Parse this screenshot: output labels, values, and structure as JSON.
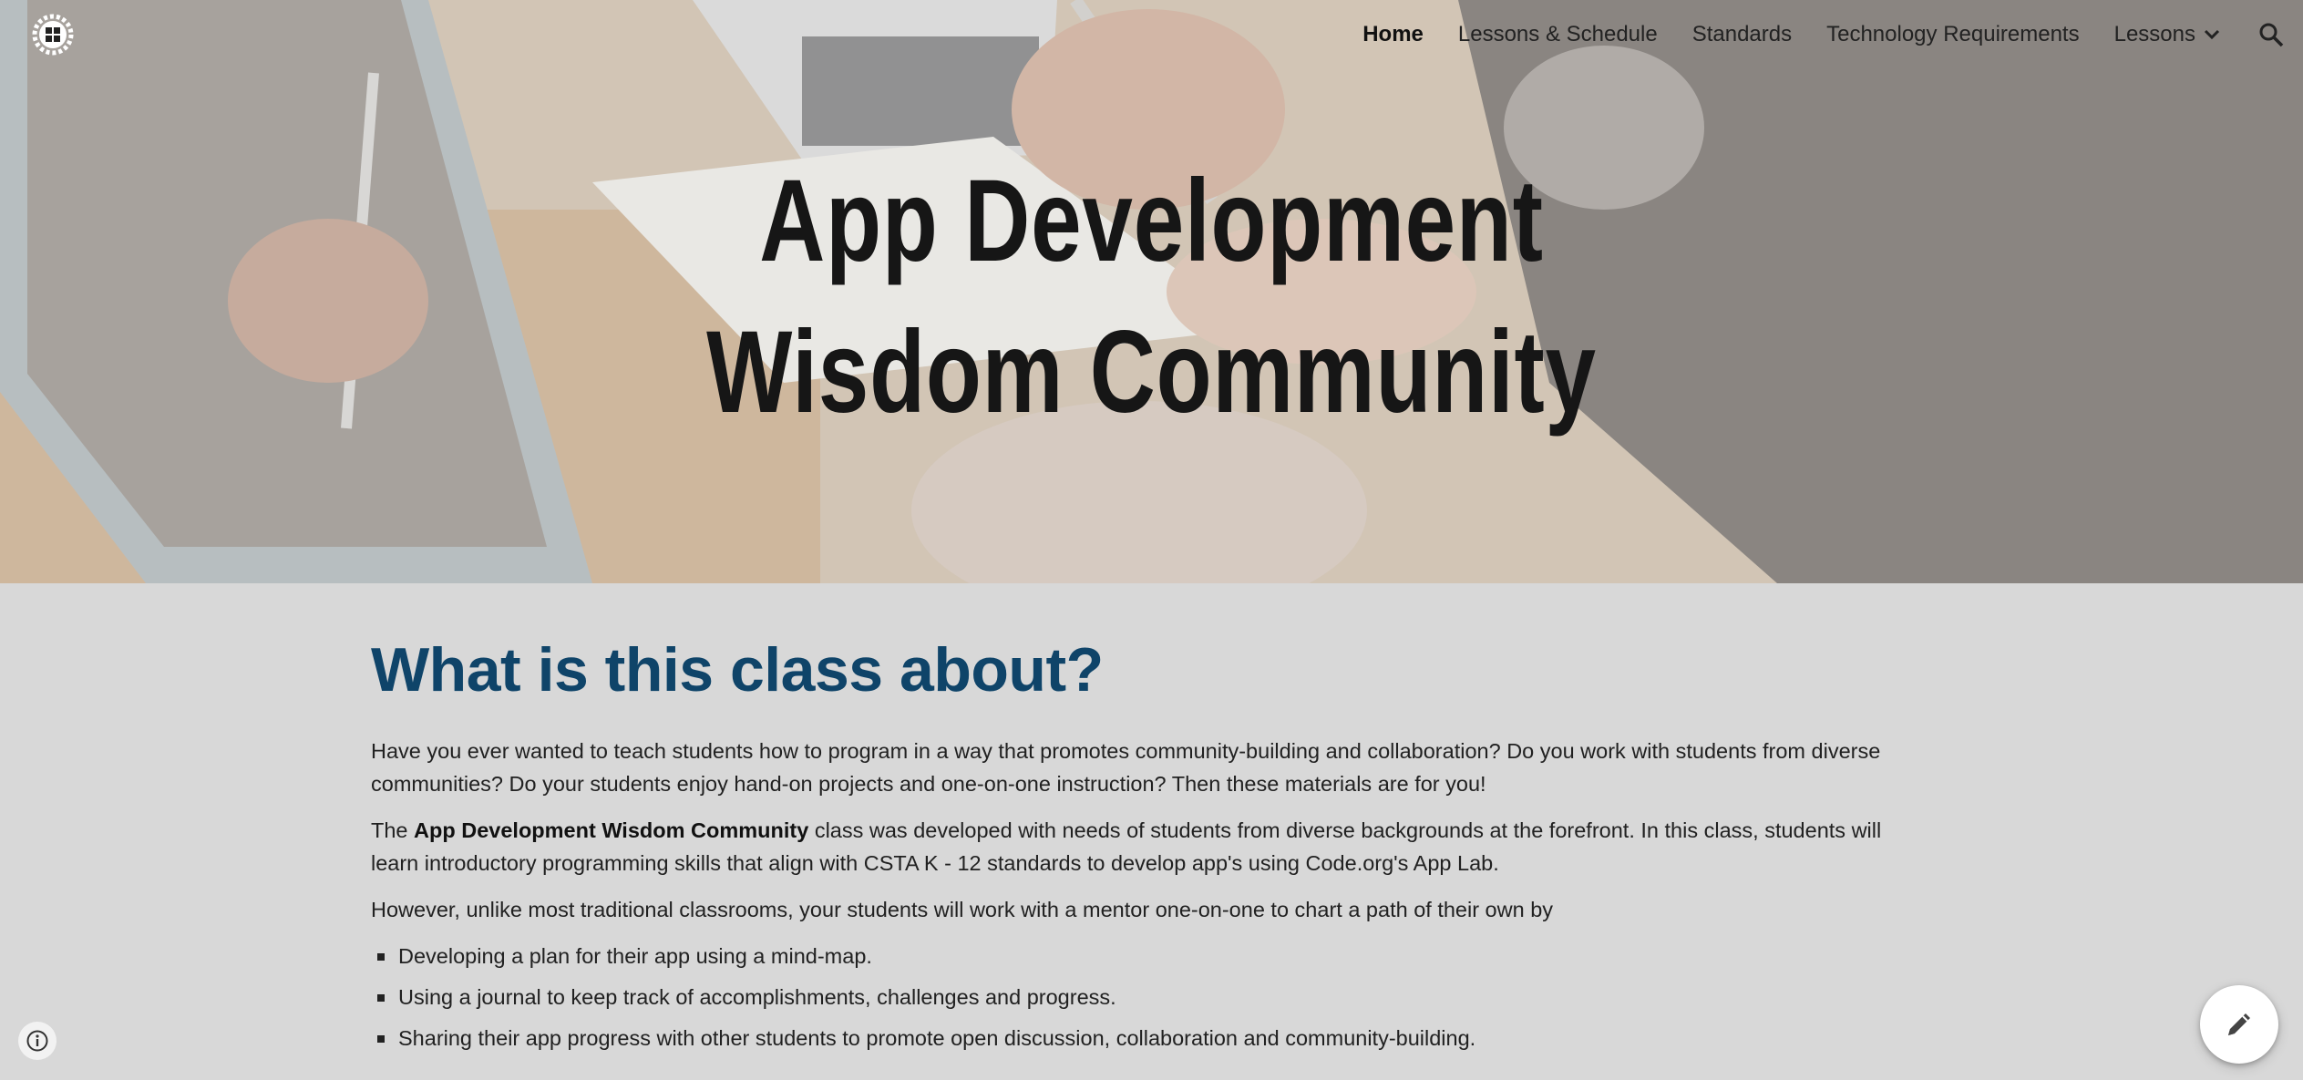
{
  "header": {
    "logo_icon": "site-logo-icon",
    "nav": [
      {
        "label": "Home",
        "active": true
      },
      {
        "label": "Lessons & Schedule",
        "active": false
      },
      {
        "label": "Standards",
        "active": false
      },
      {
        "label": "Technology Requirements",
        "active": false
      }
    ],
    "dropdown": {
      "label": "Lessons",
      "icon": "chevron-down-icon"
    },
    "search_icon": "search-icon"
  },
  "hero": {
    "title_line1": "App Development",
    "title_line2": "Wisdom Community"
  },
  "main": {
    "heading": "What is this class about?",
    "para1": "Have you ever wanted to teach students how to program in a way that promotes community-building and collaboration? Do you work with students from diverse communities? Do your students enjoy hand-on projects and one-on-one instruction? Then these materials are for you!",
    "para2_prefix": "The ",
    "para2_bold": "App Development Wisdom Community",
    "para2_suffix": " class was developed with needs of students from diverse backgrounds at the forefront. In this class, students will learn introductory programming skills that align with CSTA K - 12 standards to develop app's using Code.org's App Lab.",
    "para3": "However, unlike most traditional classrooms, your students will work with a mentor one-on-one to chart a path of their own by",
    "bullets": [
      "Developing a plan for their app using a mind-map.",
      "Using a journal to keep track of accomplishments, challenges and progress.",
      "Sharing their app progress with other students to promote open discussion, collaboration and community-building."
    ]
  },
  "floating": {
    "info_icon": "info-icon",
    "edit_icon": "pencil-edit-icon"
  },
  "colors": {
    "heading": "#0f4469",
    "page_background": "#d8d8d8",
    "title_text": "#161616"
  }
}
